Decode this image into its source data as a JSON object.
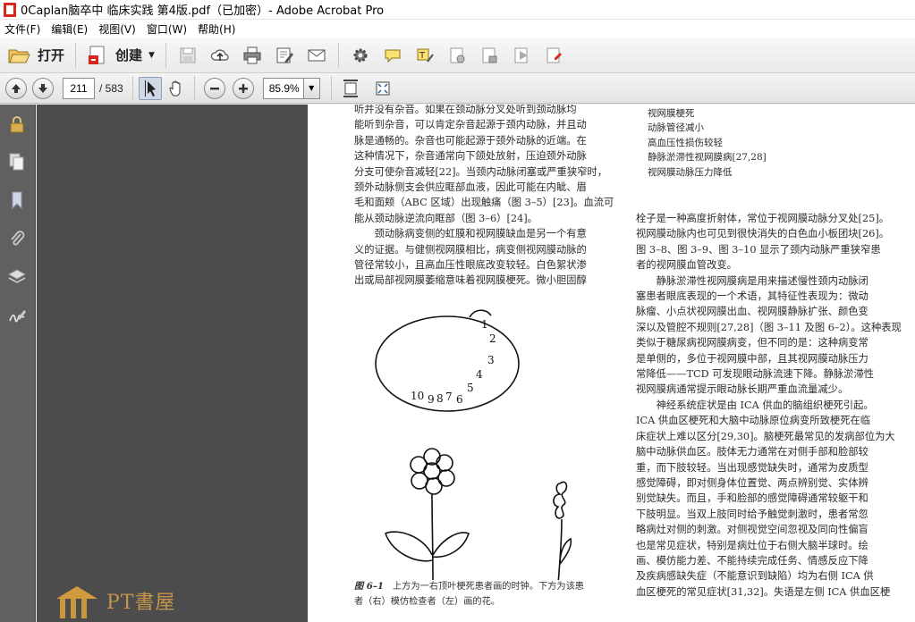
{
  "window": {
    "title": "0Caplan脑卒中  临床实践  第4版.pdf（已加密）- Adobe Acrobat Pro"
  },
  "menu": [
    "文件(F)",
    "编辑(E)",
    "视图(V)",
    "窗口(W)",
    "帮助(H)"
  ],
  "toolbar": {
    "open_label": "打开",
    "create_label": "创建"
  },
  "nav": {
    "current_page": "211",
    "total_pages": "/ 583",
    "zoom": "85.9%"
  },
  "document": {
    "left_lines": [
      "听并没有杂音。如果在颈动脉分叉处听到颈动脉均",
      "能听到杂音，可以肯定杂音起源于颈内动脉，并且动",
      "脉是通畅的。杂音也可能起源于颈外动脉的近端。在",
      "这种情况下，杂音通常向下颌处放射，压迫颈外动脉",
      "分支可使杂音减轻[22]。当颈内动脉闭塞或严重狭窄时，",
      "颈外动脉侧支会供应眶部血液，因此可能在内眦、眉",
      "毛和面颊（ABC 区域）出现触痛（图 3–5）[23]。血流可",
      "能从颈动脉逆流向眶部（图 3–6）[24]。",
      "　　颈动脉病变侧的虹膜和视网膜缺血是另一个有意",
      "义的证据。与健侧视网膜相比，病变侧视网膜动脉的",
      "管径常较小，且高血压性眼底改变较轻。白色絮状渗",
      "出或局部视网膜萎缩意味着视网膜梗死。微小胆固醇"
    ],
    "list_items": [
      "视网膜梗死",
      "动脉管径减小",
      "高血压性损伤较轻",
      "静脉淤滞性视网膜病[27,28]",
      "视网膜动脉压力降低"
    ],
    "right_lines": [
      "栓子是一种高度折射体，常位于视网膜动脉分叉处[25]。",
      "视网膜动脉内也可见到很快消失的白色血小板团块[26]。",
      "图 3–8、图 3–9、图 3–10 显示了颈内动脉严重狭窄患",
      "者的视网膜血管改变。",
      "　　静脉淤滞性视网膜病是用来描述慢性颈内动脉闭",
      "塞患者眼底表现的一个术语，其特征性表现为：微动",
      "脉瘤、小点状视网膜出血、视网膜静脉扩张、颜色变",
      "深以及管腔不规则[27,28]（图 3–11 及图 6–2）。这种表现",
      "类似于糖尿病视网膜病变，但不同的是：这种病变常",
      "是单侧的，多位于视网膜中部，且其视网膜动脉压力",
      "常降低——TCD 可发现眼动脉流速下降。静脉淤滞性",
      "视网膜病通常提示眼动脉长期严重血流量减少。",
      "　　神经系统症状是由 ICA 供血的脑组织梗死引起。",
      "ICA 供血区梗死和大脑中动脉原位病变所致梗死在临",
      "床症状上难以区分[29,30]。脑梗死最常见的发病部位为大",
      "脑中动脉供血区。肢体无力通常在对侧手部和脸部较",
      "重，而下肢较轻。当出现感觉缺失时，通常为皮质型",
      "感觉障碍，即对侧身体位置觉、两点辨别觉、实体辨",
      "别觉缺失。而且，手和脸部的感觉障碍通常较躯干和",
      "下肢明显。当双上肢同时给予触觉刺激时，患者常忽",
      "略病灶对侧的刺激。对侧视觉空间忽视及同向性偏盲",
      "也是常见症状，特别是病灶位于右侧大脑半球时。绘",
      "画、模仿能力差、不能持续完成任务、情感反应下降",
      "及疾病感缺失症（不能意识到缺陷）均为右侧 ICA 供",
      "血区梗死的常见症状[31,32]。失语是左侧 ICA 供血区梗"
    ],
    "figure_caption_num": "图 6–1",
    "figure_caption_line1": "上方为一右顶叶梗死患者画的时钟。下方为该患",
    "figure_caption_line2": "者（右）模仿检查者（左）画的花。",
    "clock_digits": [
      "1",
      "2",
      "3",
      "4",
      "5",
      "6",
      "7",
      "8",
      "9",
      "10"
    ]
  },
  "watermark": {
    "text": "PT書屋"
  },
  "icons": {
    "open": "folder-open-icon",
    "create": "create-pdf-icon",
    "save": "save-icon",
    "upload": "cloud-upload-icon",
    "print": "print-icon",
    "edit": "edit-document-icon",
    "email": "email-icon",
    "settings": "gear-icon",
    "comment": "comment-icon",
    "highlight": "highlight-text-icon"
  },
  "colors": {
    "viewer_bg": "#4c4c4c",
    "nav_bg": "#606060",
    "pdf_red": "#d8261f"
  }
}
